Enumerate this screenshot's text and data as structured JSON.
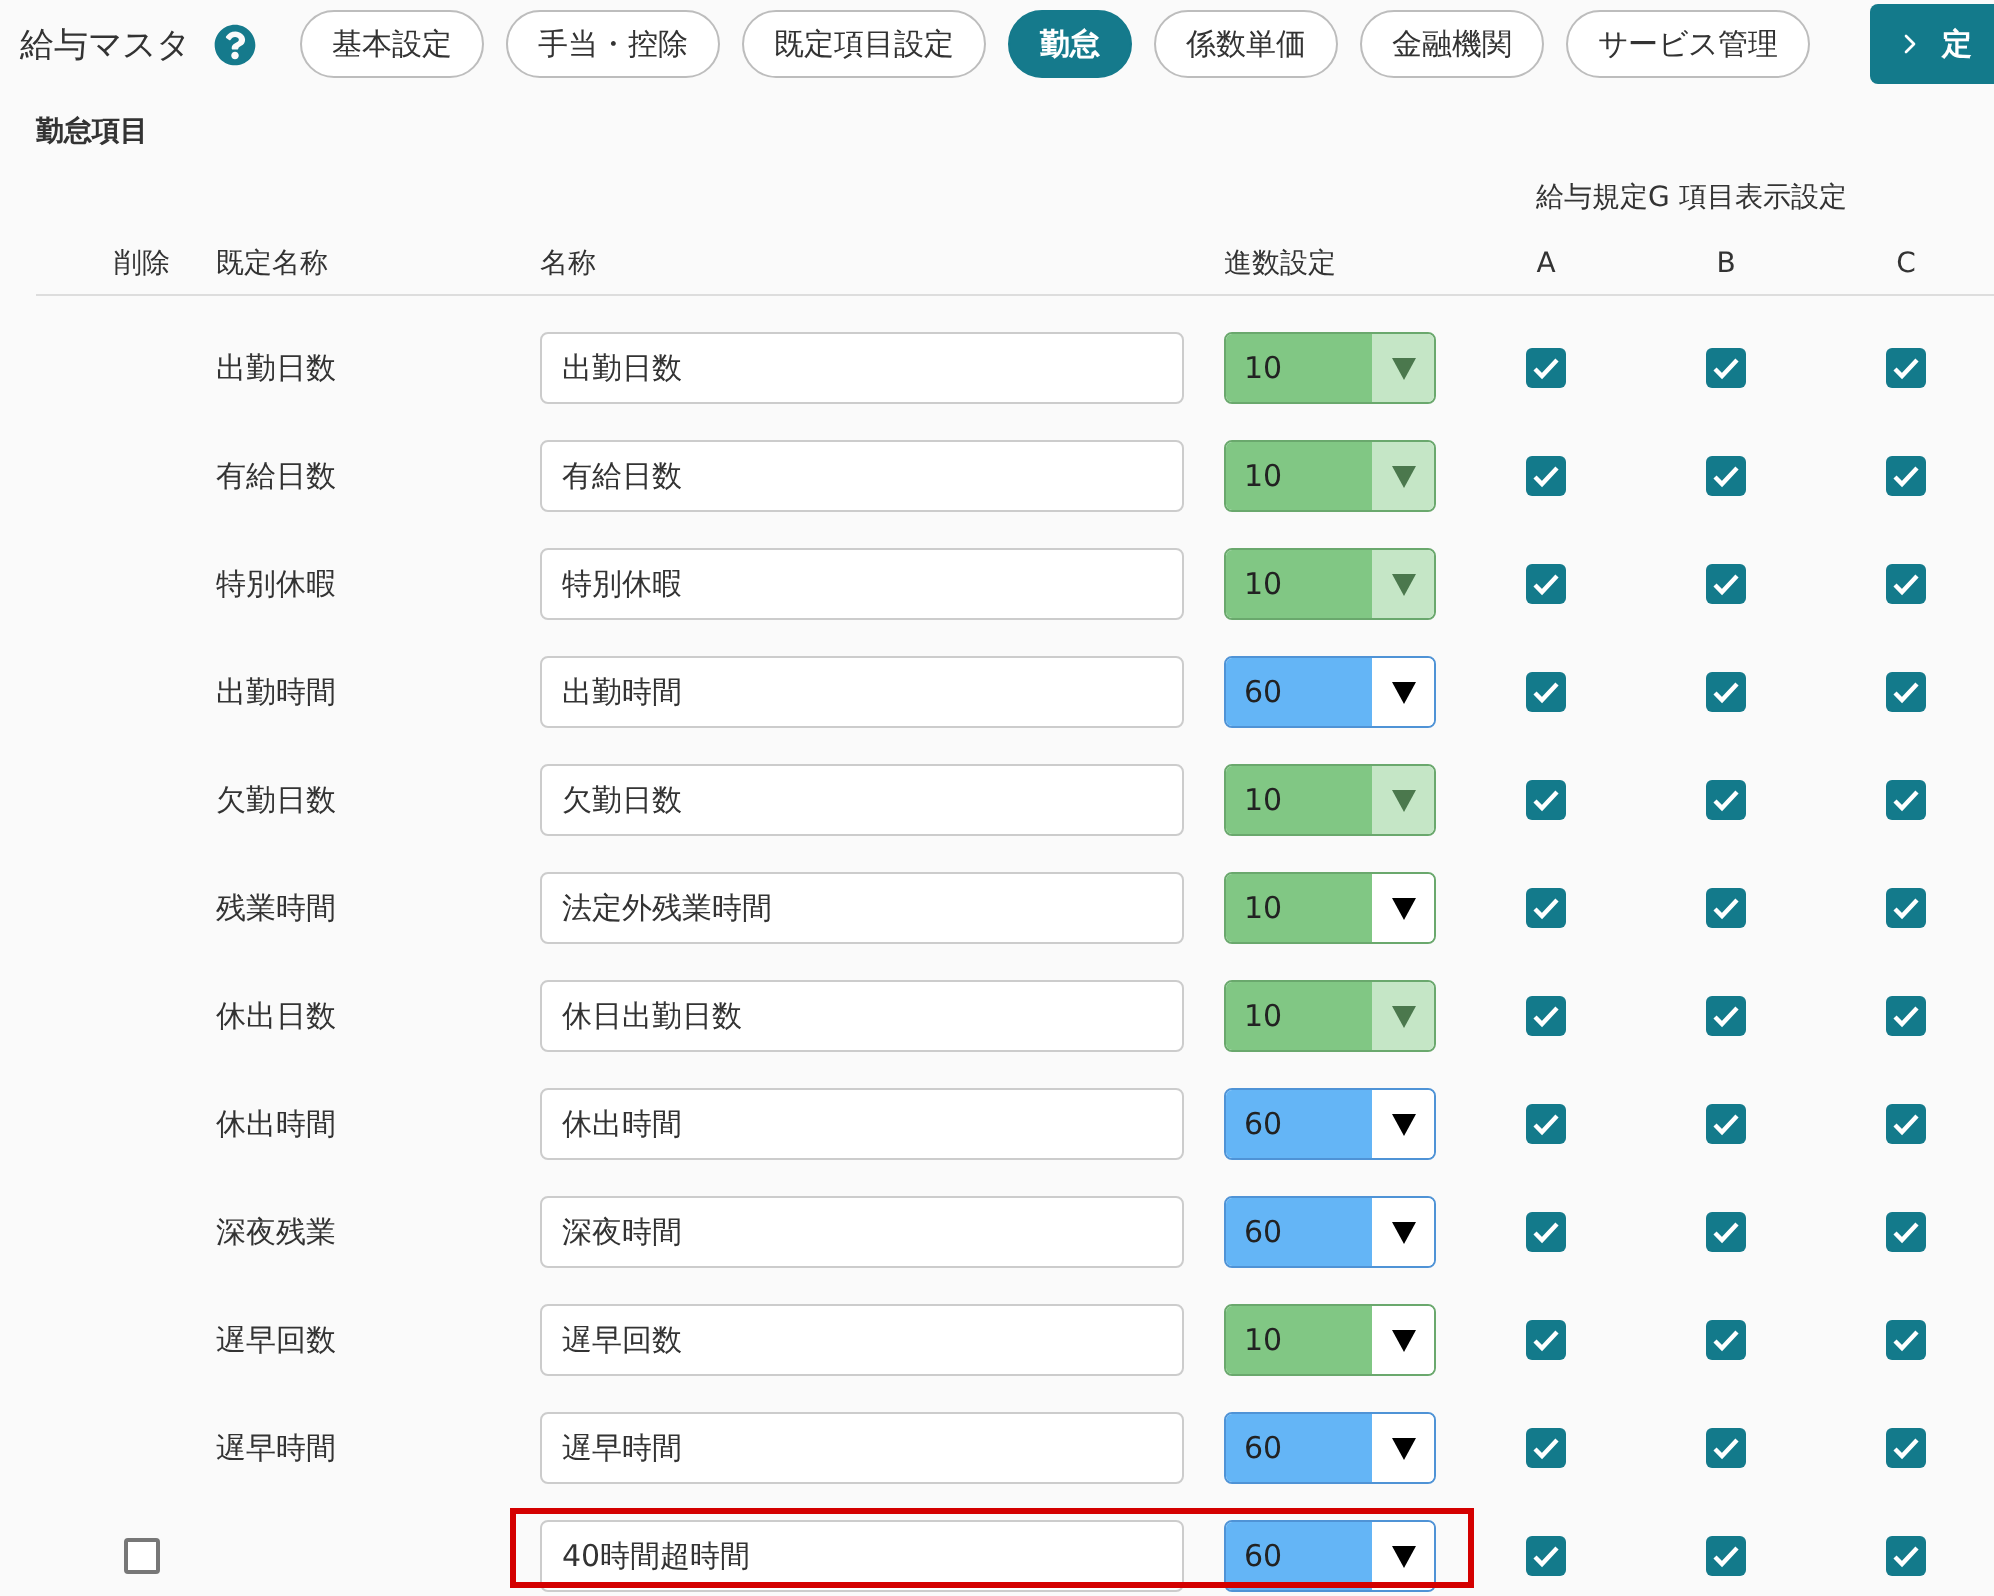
{
  "page": {
    "title": "給与マスタ"
  },
  "tabs": [
    {
      "label": "基本設定",
      "selected": false
    },
    {
      "label": "手当・控除",
      "selected": false
    },
    {
      "label": "既定項目設定",
      "selected": false
    },
    {
      "label": "勤怠",
      "selected": true
    },
    {
      "label": "係数単価",
      "selected": false
    },
    {
      "label": "金融機関",
      "selected": false
    },
    {
      "label": "サービス管理",
      "selected": false
    }
  ],
  "action_button": {
    "label": "定"
  },
  "section": {
    "title": "勤怠項目"
  },
  "table": {
    "group_heading": "給与規定G 項目表示設定",
    "columns": {
      "delete": "削除",
      "default_name": "既定名称",
      "name": "名称",
      "unit": "進数設定",
      "groups": [
        "A",
        "B",
        "C"
      ]
    },
    "rows": [
      {
        "default_name": "出勤日数",
        "name": "出勤日数",
        "unit": {
          "value": "10",
          "color": "#81c784",
          "disabled": true
        },
        "show": [
          true,
          true,
          true
        ],
        "highlighted": false
      },
      {
        "default_name": "有給日数",
        "name": "有給日数",
        "unit": {
          "value": "10",
          "color": "#81c784",
          "disabled": true
        },
        "show": [
          true,
          true,
          true
        ],
        "highlighted": false
      },
      {
        "default_name": "特別休暇",
        "name": "特別休暇",
        "unit": {
          "value": "10",
          "color": "#81c784",
          "disabled": true
        },
        "show": [
          true,
          true,
          true
        ],
        "highlighted": false
      },
      {
        "default_name": "出勤時間",
        "name": "出勤時間",
        "unit": {
          "value": "60",
          "color": "#64b5f6",
          "disabled": false
        },
        "show": [
          true,
          true,
          true
        ],
        "highlighted": false
      },
      {
        "default_name": "欠勤日数",
        "name": "欠勤日数",
        "unit": {
          "value": "10",
          "color": "#81c784",
          "disabled": true
        },
        "show": [
          true,
          true,
          true
        ],
        "highlighted": false
      },
      {
        "default_name": "残業時間",
        "name": "法定外残業時間",
        "unit": {
          "value": "10",
          "color": "#81c784",
          "disabled": false
        },
        "show": [
          true,
          true,
          true
        ],
        "highlighted": false
      },
      {
        "default_name": "休出日数",
        "name": "休日出勤日数",
        "unit": {
          "value": "10",
          "color": "#81c784",
          "disabled": true
        },
        "show": [
          true,
          true,
          true
        ],
        "highlighted": false
      },
      {
        "default_name": "休出時間",
        "name": "休出時間",
        "unit": {
          "value": "60",
          "color": "#64b5f6",
          "disabled": false
        },
        "show": [
          true,
          true,
          true
        ],
        "highlighted": false
      },
      {
        "default_name": "深夜残業",
        "name": "深夜時間",
        "unit": {
          "value": "60",
          "color": "#64b5f6",
          "disabled": false
        },
        "show": [
          true,
          true,
          true
        ],
        "highlighted": false
      },
      {
        "default_name": "遅早回数",
        "name": "遅早回数",
        "unit": {
          "value": "10",
          "color": "#81c784",
          "disabled": false
        },
        "show": [
          true,
          true,
          true
        ],
        "highlighted": false
      },
      {
        "default_name": "遅早時間",
        "name": "遅早時間",
        "unit": {
          "value": "60",
          "color": "#64b5f6",
          "disabled": false
        },
        "show": [
          true,
          true,
          true
        ],
        "highlighted": false
      },
      {
        "delete": {
          "checked": false
        },
        "name": "40時間超時間",
        "unit": {
          "value": "60",
          "color": "#64b5f6",
          "disabled": false
        },
        "show": [
          true,
          true,
          true
        ],
        "highlighted": true
      }
    ]
  }
}
